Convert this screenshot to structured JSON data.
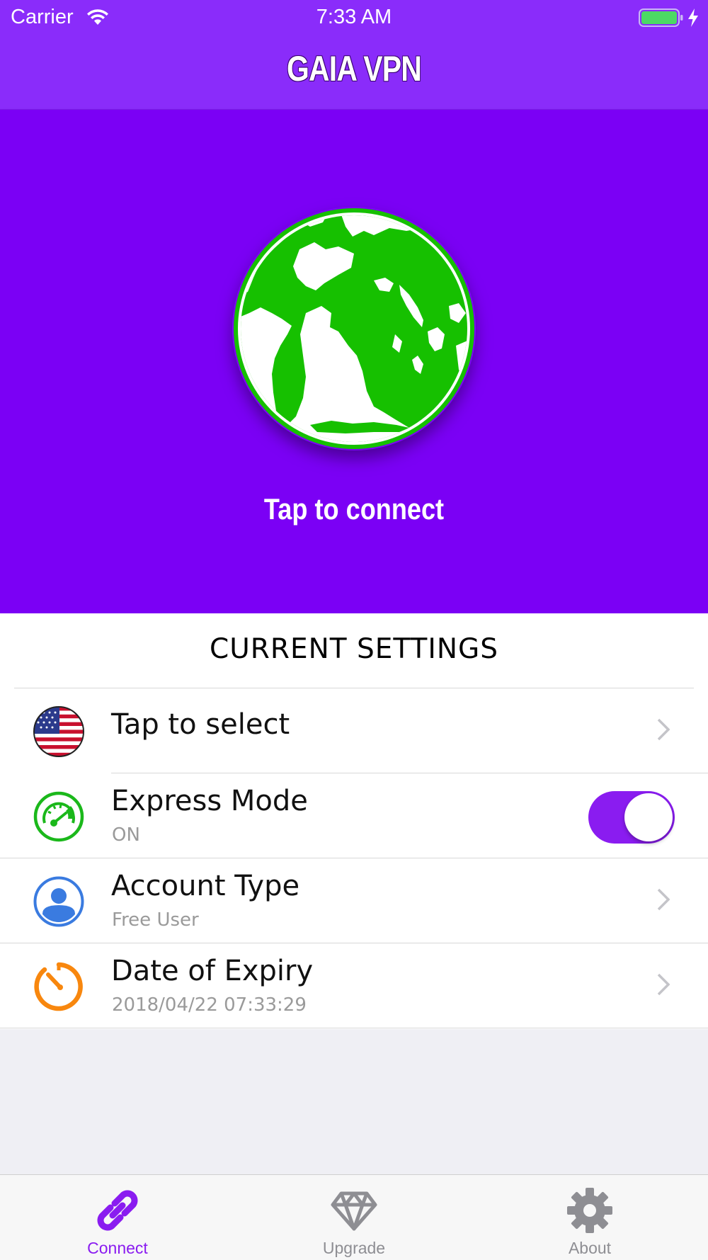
{
  "status_bar": {
    "carrier": "Carrier",
    "time": "7:33 AM"
  },
  "nav": {
    "title": "GAIA VPN"
  },
  "hero": {
    "action_label": "Tap to connect"
  },
  "settings": {
    "header": "CURRENT SETTINGS",
    "rows": [
      {
        "title": "Tap to select",
        "subtitle": "",
        "icon": "us-flag-icon"
      },
      {
        "title": "Express Mode",
        "subtitle": "ON",
        "icon": "speedometer-icon",
        "toggle_on": true
      },
      {
        "title": "Account Type",
        "subtitle": "Free User",
        "icon": "user-icon"
      },
      {
        "title": "Date of Expiry",
        "subtitle": "2018/04/22 07:33:29",
        "icon": "timer-icon"
      }
    ]
  },
  "tabs": [
    {
      "label": "Connect",
      "icon": "link-icon",
      "active": true
    },
    {
      "label": "Upgrade",
      "icon": "diamond-icon",
      "active": false
    },
    {
      "label": "About",
      "icon": "gear-icon",
      "active": false
    }
  ],
  "colors": {
    "brand_purple": "#7b00f5",
    "nav_purple": "#8a2cfa",
    "globe_green": "#16c000",
    "express_green": "#1bb81b",
    "account_blue": "#3a7be0",
    "expiry_orange": "#f8870e",
    "active_tab": "#8a1cf0",
    "inactive_tab": "#8e8e93"
  }
}
